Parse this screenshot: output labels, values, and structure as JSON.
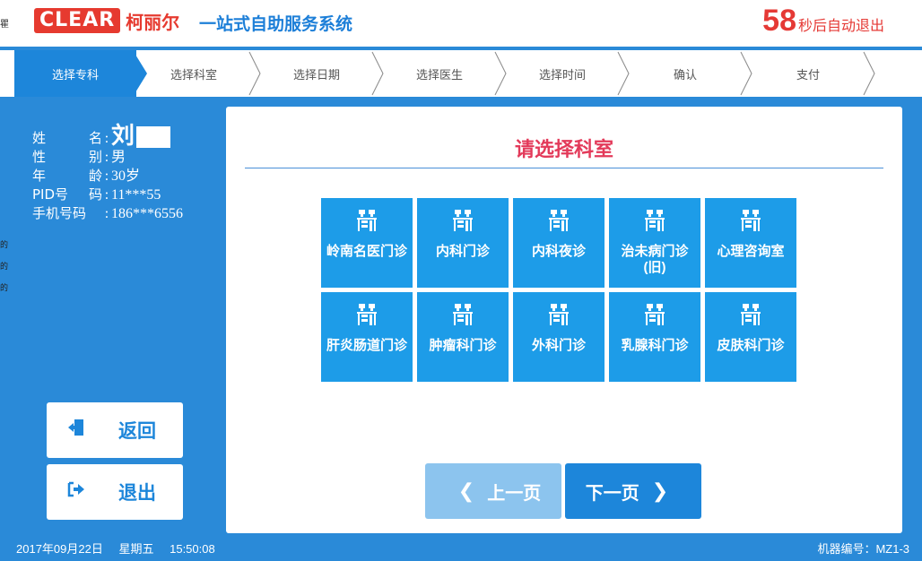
{
  "header": {
    "logo_mark": "CLEAR",
    "logo_name": "柯丽尔",
    "system_title": "一站式自助服务系统",
    "countdown_value": "58",
    "countdown_text": "秒后自动退出",
    "edge_mark": "瞿"
  },
  "steps": [
    {
      "label": "选择专科",
      "active": true
    },
    {
      "label": "选择科室",
      "active": false
    },
    {
      "label": "选择日期",
      "active": false
    },
    {
      "label": "选择医生",
      "active": false
    },
    {
      "label": "选择时间",
      "active": false
    },
    {
      "label": "确认",
      "active": false
    },
    {
      "label": "支付",
      "active": false
    }
  ],
  "patient": {
    "name_label": [
      "姓",
      "名"
    ],
    "name_value": "刘",
    "gender_label": [
      "性",
      "别"
    ],
    "gender_value": "男",
    "age_label": [
      "年",
      "龄"
    ],
    "age_value": "30岁",
    "pid_label": [
      "PID号",
      "码"
    ],
    "pid_value": "11***55",
    "phone_label": "手机号码",
    "phone_value": "186***6556"
  },
  "left_edge_chars": [
    "的",
    "的",
    "的"
  ],
  "buttons": {
    "back_label": "返回",
    "exit_label": "退出"
  },
  "main": {
    "title": "请选择科室",
    "departments": [
      {
        "label": "岭南名医门诊"
      },
      {
        "label": "内科门诊"
      },
      {
        "label": "内科夜诊"
      },
      {
        "label": "治未病门诊(旧)"
      },
      {
        "label": "心理咨询室"
      },
      {
        "label": "肝炎肠道门诊"
      },
      {
        "label": "肿瘤科门诊"
      },
      {
        "label": "外科门诊"
      },
      {
        "label": "乳腺科门诊"
      },
      {
        "label": "皮肤科门诊"
      }
    ],
    "prev_label": "上一页",
    "next_label": "下一页"
  },
  "footer": {
    "date": "2017年09月22日",
    "weekday": "星期五",
    "time": "15:50:08",
    "machine": "机器编号：MZ1-3"
  },
  "colors": {
    "background": "#2a8ad8",
    "accent": "#1d86da",
    "tile": "#1d9ce8",
    "title_red": "#e33a5a",
    "countdown_red": "#e53935"
  }
}
